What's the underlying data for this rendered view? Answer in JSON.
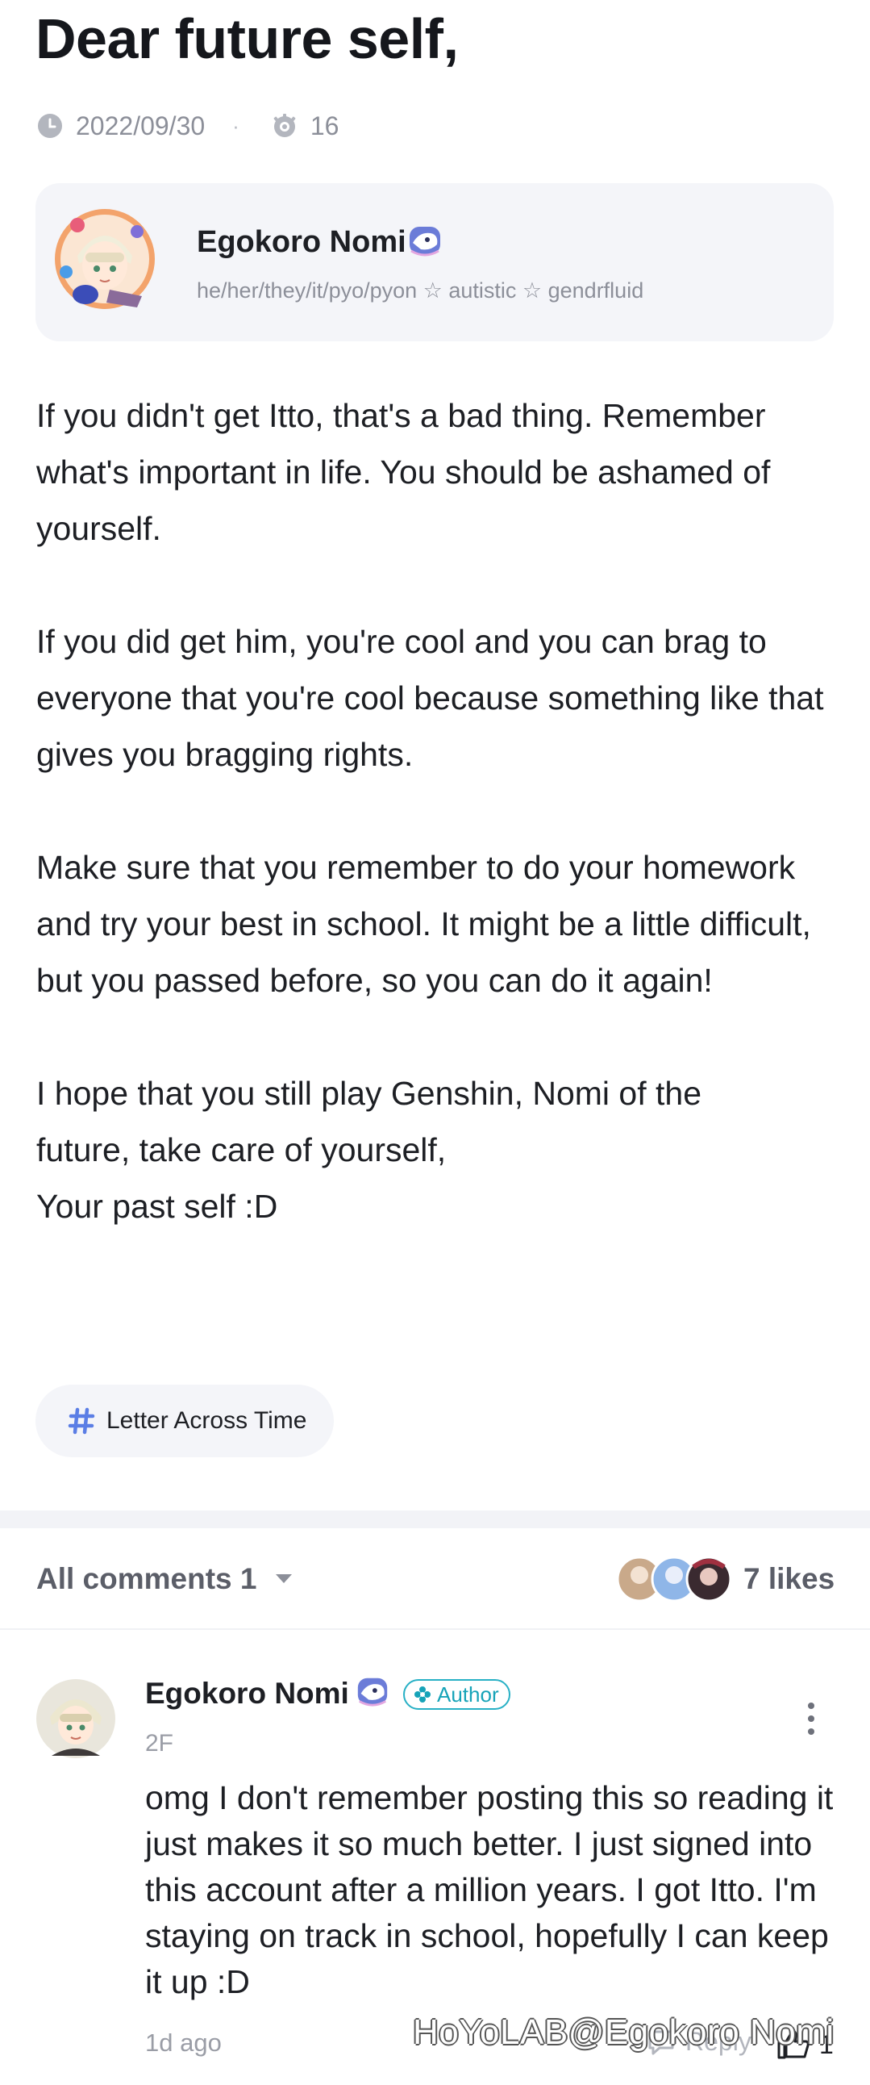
{
  "post": {
    "title": "Dear future self,",
    "date": "2022/09/30",
    "separator": "·",
    "views": "16",
    "paragraphs": [
      "If you didn't get Itto, that's a bad thing. Remember what's important in life. You should be ashamed of yourself.",
      "If you did get him, you're cool and you can brag to everyone that you're cool because something like that gives you bragging rights.",
      "Make sure that you remember to do your homework and try your best in school. It might be a little difficult, but you passed before, so you can do it again!"
    ],
    "closing_lines": [
      "I hope that you still play Genshin, Nomi of the",
      "future, take care of yourself,",
      "Your past self :D"
    ],
    "tag": "Letter Across Time"
  },
  "author": {
    "name": "Egokoro Nomi",
    "bio": "he/her/they/it/pyo/pyon ☆ autistic ☆ gendrfluid"
  },
  "comments_section": {
    "label": "All comments 1",
    "likes": "7 likes"
  },
  "comment": {
    "name": "Egokoro Nomi",
    "author_tag": "Author",
    "floor": "2F",
    "text": "omg I don't remember posting this so reading it just makes it so much better. I just signed into this account after a million years. I got Itto. I'm staying on track in school, hopefully I can keep it up :D",
    "time": "1d ago",
    "reply_label": "Reply",
    "like_count": "1"
  },
  "watermark": "HoYoLAB@Egokoro Nomi",
  "colors": {
    "accent_tag": "#5b7ee5",
    "author_tag": "#16a3b8",
    "card_bg": "#f4f5f9",
    "muted_text": "#8c8f99"
  },
  "icons": {
    "date": "clock-icon",
    "views": "eye-icon",
    "badge": "creature-badge-icon",
    "tag": "hashtag-icon",
    "sort": "caret-down-icon",
    "more": "more-vertical-icon",
    "reply": "reply-icon",
    "like": "thumbs-up-icon"
  }
}
